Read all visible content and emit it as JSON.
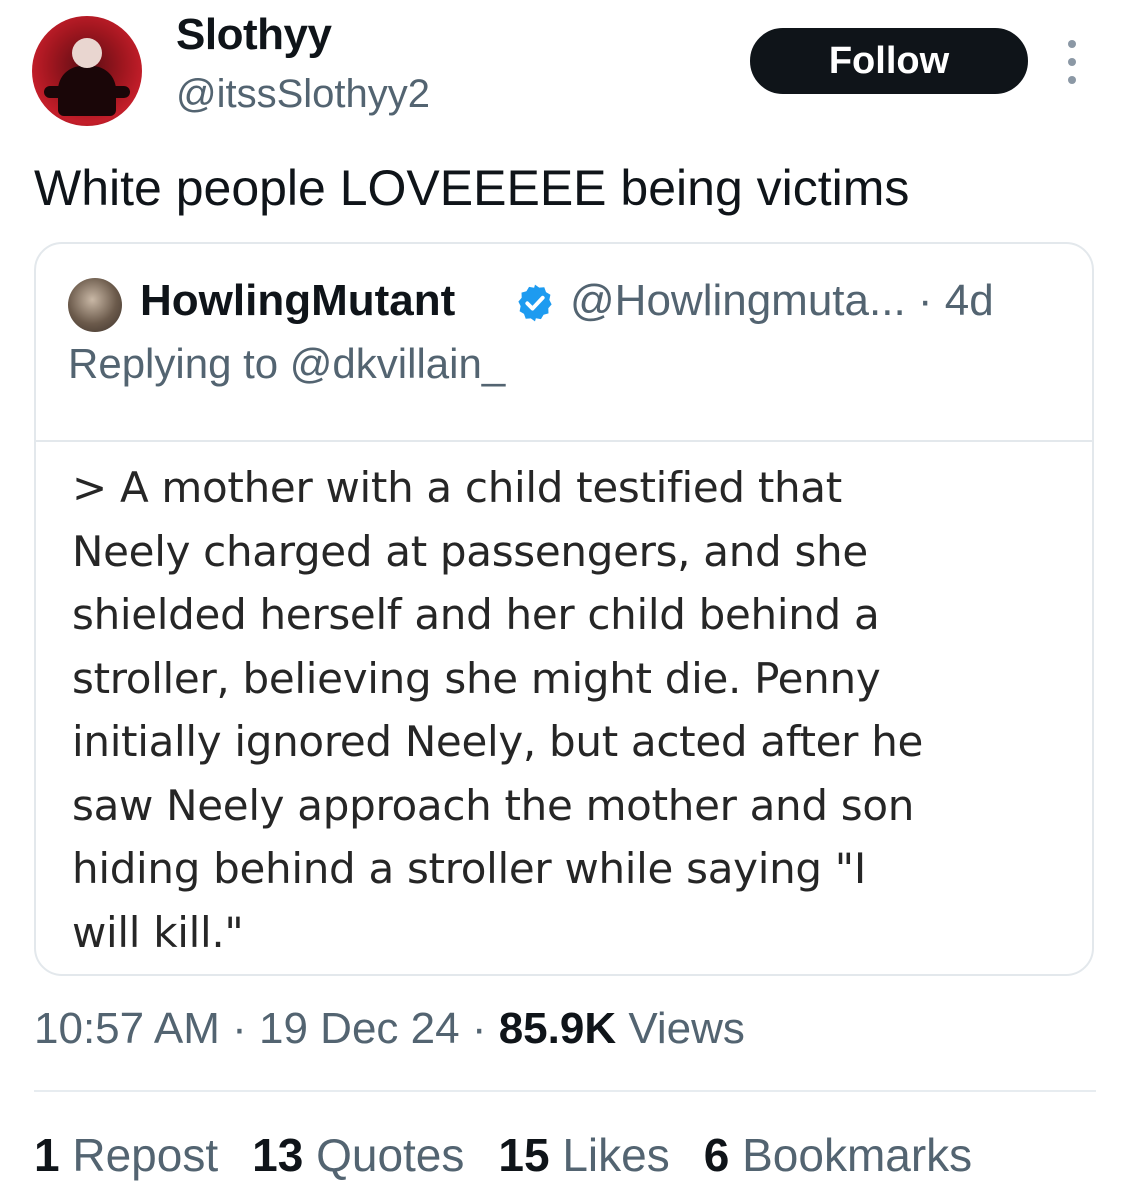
{
  "author": {
    "display_name": "Slothyy",
    "handle": "@itssSlothyy2"
  },
  "follow_label": "Follow",
  "tweet_text": "White people LOVEEEEE being victims",
  "quote": {
    "display_name": "HowlingMutant",
    "handle": "@Howlingmuta...",
    "time": "· 4d",
    "replying_to": "Replying to @dkvillain_",
    "body": "> A mother with a child testified that\nNeely charged at passengers, and she\nshielded herself and her child behind a\nstroller, believing she might die. Penny\ninitially ignored Neely, but acted after he\nsaw Neely approach the mother and son\nhiding behind a stroller while saying \"I\nwill kill.\""
  },
  "meta": {
    "time": "10:57 AM",
    "sep1": " · ",
    "date": "19 Dec 24",
    "sep2": " · ",
    "views_count": "85.9K",
    "views_label": " Views"
  },
  "stats": {
    "reposts_count": "1",
    "reposts_label": " Repost",
    "quotes_count": "13",
    "quotes_label": " Quotes",
    "likes_count": "15",
    "likes_label": " Likes",
    "bookmarks_count": "6",
    "bookmarks_label": " Bookmarks"
  },
  "colors": {
    "primary_text": "#0f1419",
    "secondary_text": "#536471",
    "verified_blue": "#1d9bf0",
    "avatar_red": "#c41e2a"
  },
  "icons": {
    "more": "more-vertical-icon",
    "verified": "verified-badge-icon"
  }
}
